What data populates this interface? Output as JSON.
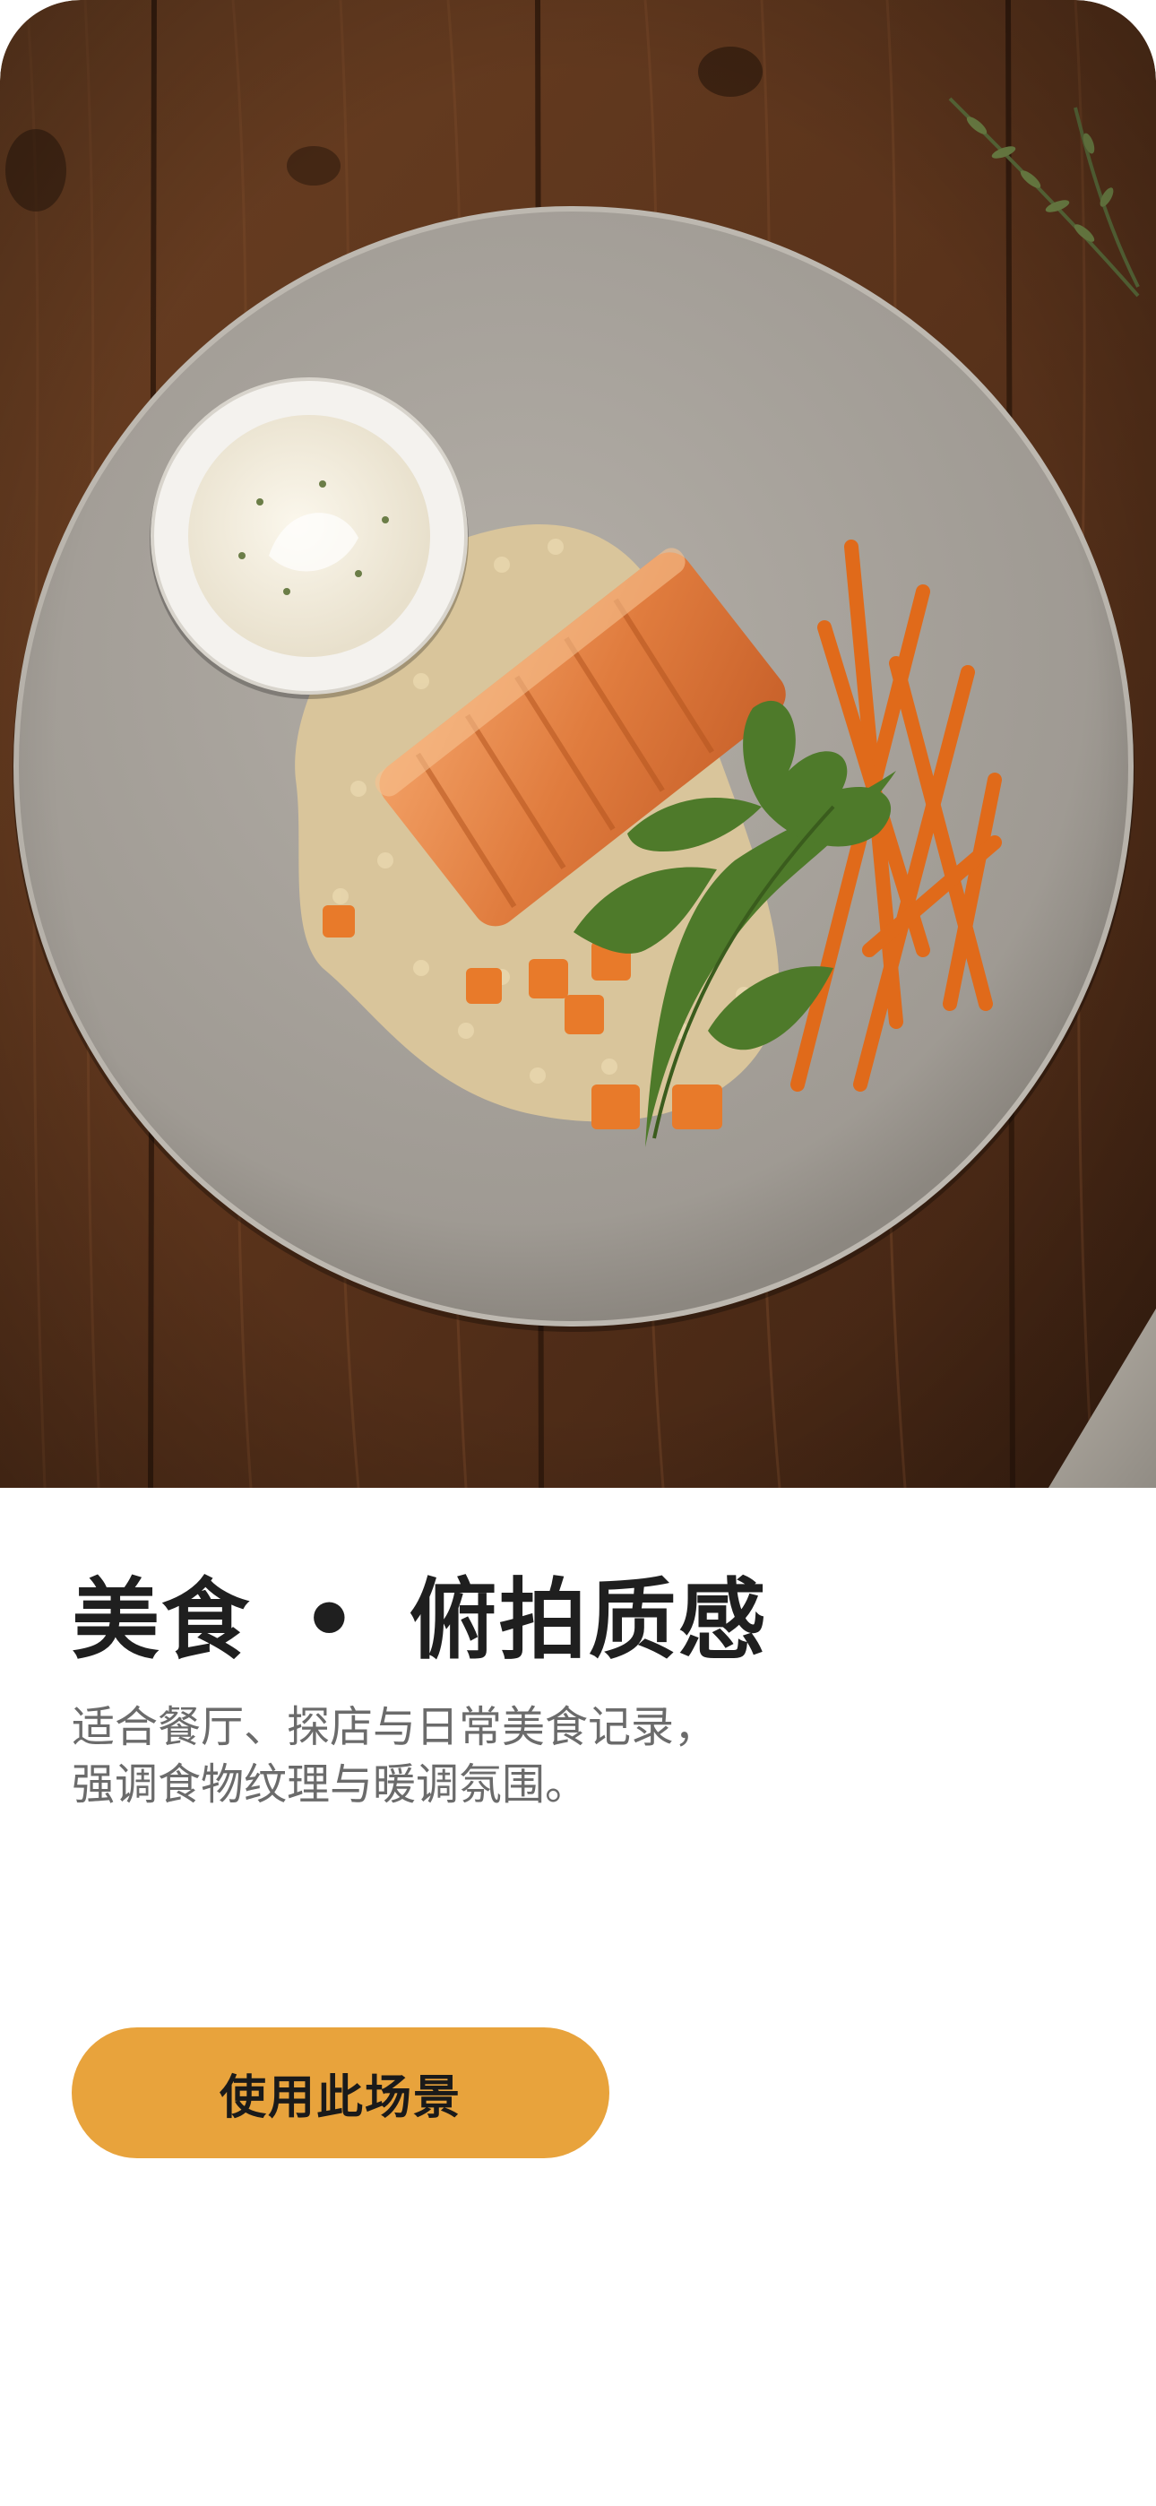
{
  "hero": {
    "image_icon": "food-overhead-photo"
  },
  "scene": {
    "title_left": "美食",
    "title_sep": "•",
    "title_right": "俯拍质感",
    "desc_line1": "适合餐厅、探店与日常美食记录，",
    "desc_line2": "强调食物纹理与暖调氛围。"
  },
  "action": {
    "use_label": "使用此场景"
  },
  "colors": {
    "accent": "#e8a33c",
    "title": "#1f1f1f",
    "desc": "#6b6b6b",
    "wood": "#5a3520",
    "plate": "#a7a29b"
  }
}
